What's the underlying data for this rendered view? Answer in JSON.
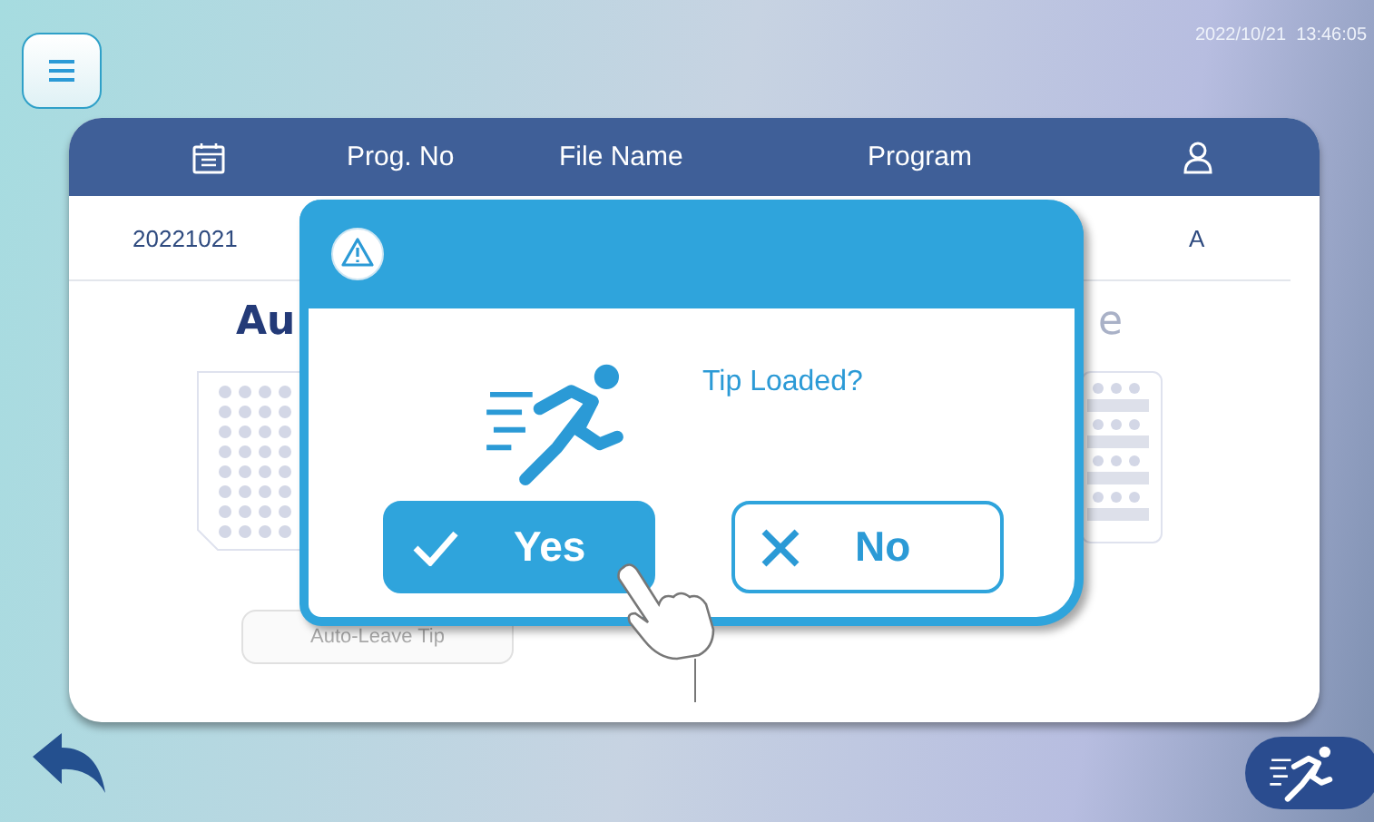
{
  "status_bar": {
    "timestamp": "2022/10/21  13:46:05"
  },
  "table": {
    "columns": [
      "Prog. No",
      "File Name",
      "Program"
    ],
    "row": {
      "date": "20221021",
      "user": "A"
    }
  },
  "panels": [
    {
      "title": "Au",
      "kind": "wells"
    },
    {
      "title": "e",
      "kind": "strips"
    }
  ],
  "auto_leave_button": {
    "label": "Auto-Leave Tip",
    "disabled": true
  },
  "dialog": {
    "message": "Tip Loaded?",
    "buttons": [
      {
        "label": "Yes",
        "kind": "confirm",
        "selected": true
      },
      {
        "label": "No",
        "kind": "cancel",
        "selected": false
      }
    ]
  }
}
